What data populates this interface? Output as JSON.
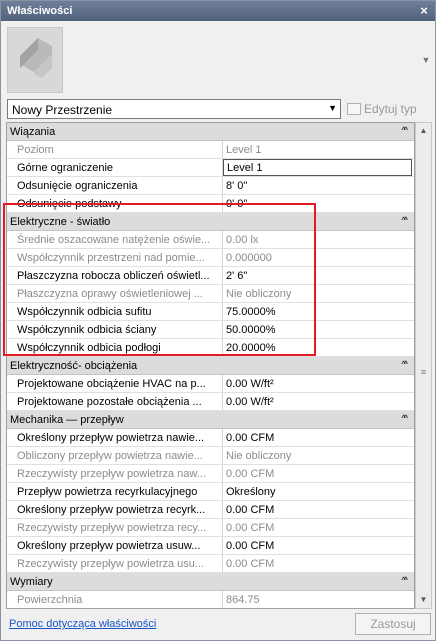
{
  "window": {
    "title": "Właściwości",
    "close_glyph": "×"
  },
  "type_selector": {
    "value": "Nowy Przestrzenie",
    "edit_type_label": "Edytuj typ"
  },
  "sections": [
    {
      "title": "Wiązania",
      "rows": [
        {
          "name": "Poziom",
          "value": "Level 1",
          "disabled": true
        },
        {
          "name": "Górne ograniczenie",
          "value": "Level 1",
          "disabled": false,
          "boxed": true
        },
        {
          "name": "Odsunięcie ograniczenia",
          "value": "8'  0\"",
          "disabled": false
        },
        {
          "name": "Odsunięcie podstawy",
          "value": "0'  0\"",
          "disabled": false
        }
      ]
    },
    {
      "title": "Elektryczne - światło",
      "rows": [
        {
          "name": "Średnie oszacowane natężenie oświe...",
          "value": "0.00 lx",
          "disabled": true
        },
        {
          "name": "Współczynnik przestrzeni nad pomie...",
          "value": "0.000000",
          "disabled": true
        },
        {
          "name": "Płaszczyzna robocza obliczeń oświetl...",
          "value": "2'  6\"",
          "disabled": false
        },
        {
          "name": "Płaszczyzna oprawy oświetleniowej ...",
          "value": "Nie obliczony",
          "disabled": true
        },
        {
          "name": "Współczynnik odbicia sufitu",
          "value": "75.0000%",
          "disabled": false
        },
        {
          "name": "Współczynnik odbicia ściany",
          "value": "50.0000%",
          "disabled": false
        },
        {
          "name": "Współczynnik odbicia podłogi",
          "value": "20.0000%",
          "disabled": false
        }
      ]
    },
    {
      "title": "Elektryczność- obciążenia",
      "rows": [
        {
          "name": "Projektowane obciążenie HVAC na p...",
          "value": "0.00 W/ft²",
          "disabled": false
        },
        {
          "name": "Projektowane pozostałe obciążenia ...",
          "value": "0.00 W/ft²",
          "disabled": false
        }
      ]
    },
    {
      "title": "Mechanika — przepływ",
      "rows": [
        {
          "name": "Określony przepływ powietrza nawie...",
          "value": "0.00 CFM",
          "disabled": false
        },
        {
          "name": "Obliczony przepływ powietrza nawie...",
          "value": "Nie obliczony",
          "disabled": true
        },
        {
          "name": "Rzeczywisty przepływ powietrza naw...",
          "value": "0.00 CFM",
          "disabled": true
        },
        {
          "name": "Przepływ powietrza recyrkulacyjnego",
          "value": "Określony",
          "disabled": false
        },
        {
          "name": "Określony przepływ powietrza recyrk...",
          "value": "0.00 CFM",
          "disabled": false
        },
        {
          "name": "Rzeczywisty przepływ powietrza recy...",
          "value": "0.00 CFM",
          "disabled": true
        },
        {
          "name": "Określony przepływ powietrza usuw...",
          "value": "0.00 CFM",
          "disabled": false
        },
        {
          "name": "Rzeczywisty przepływ powietrza usu...",
          "value": "0.00 CFM",
          "disabled": true
        }
      ]
    },
    {
      "title": "Wymiary",
      "rows": [
        {
          "name": "Powierzchnia",
          "value": "864.75",
          "disabled": true
        }
      ]
    }
  ],
  "footer": {
    "help_link": "Pomoc dotycząca właściwości",
    "apply_label": "Zastosuj"
  },
  "colors": {
    "highlight": "#e31b23",
    "section_bg": "#dcdcdc",
    "link": "#1a55c6"
  },
  "icons": {
    "collapse": "double-chevron-up-icon",
    "dropdown": "chevron-down-icon"
  }
}
